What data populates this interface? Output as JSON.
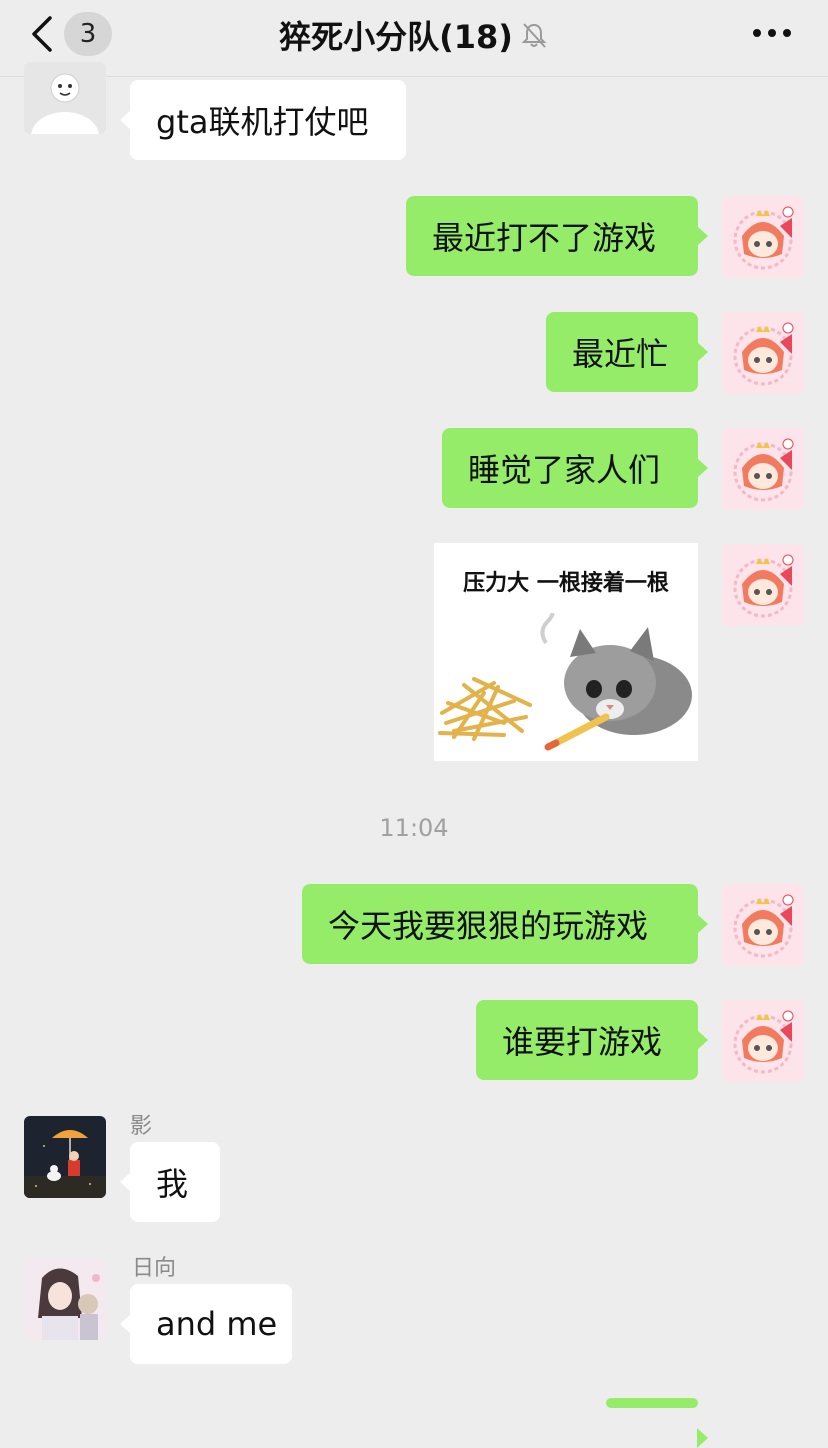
{
  "header": {
    "unread_count": "3",
    "title": "猝死小分队(18)"
  },
  "messages": {
    "m1": "gta联机打仗吧",
    "m2": "最近打不了游戏",
    "m3": "最近忙",
    "m4": "睡觉了家人们",
    "sticker_caption": "压力大 一根接着一根",
    "timestamp": "11:04",
    "m5": "今天我要狠狠的玩游戏",
    "m6": "谁要打游戏",
    "m7_sender": "影",
    "m7": "我",
    "m8_sender": "日向",
    "m8": "and me"
  },
  "colors": {
    "outgoing_bubble": "#95ec69",
    "incoming_bubble": "#ffffff",
    "background": "#ededed"
  }
}
